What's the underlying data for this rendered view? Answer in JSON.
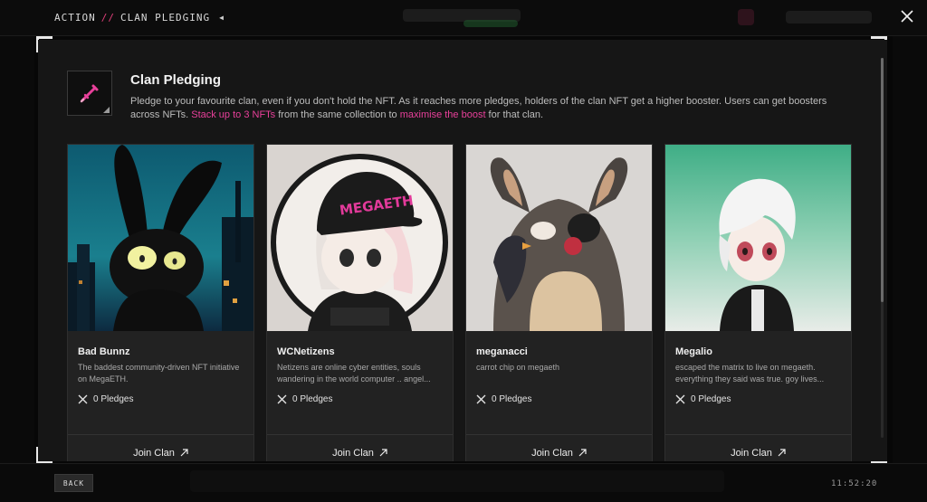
{
  "breadcrumb": {
    "section": "ACTION",
    "separator": "//",
    "page": "CLAN PLEDGING"
  },
  "modal": {
    "title": "Clan Pledging",
    "description_part1": "Pledge to your favourite clan, even if you don't hold the NFT. As it reaches more pledges, holders of the clan NFT get a higher booster. Users can get boosters across NFTs. ",
    "highlight1": "Stack up to 3 NFTs",
    "description_part2": " from the same collection to ",
    "highlight2": "maximise the boost",
    "description_part3": " for that clan."
  },
  "cards": [
    {
      "name": "Bad Bunnz",
      "description": "The baddest community-driven NFT initiative on MegaETH.",
      "pledges": "0 Pledges",
      "join_label": "Join Clan"
    },
    {
      "name": "WCNetizens",
      "description": "Netizens are online cyber entities, souls wandering in the world computer .. angel...",
      "pledges": "0 Pledges",
      "join_label": "Join Clan",
      "cap_text": "MEGAETH"
    },
    {
      "name": "meganacci",
      "description": "carrot chip on megaeth",
      "pledges": "0 Pledges",
      "join_label": "Join Clan"
    },
    {
      "name": "Megalio",
      "description": "escaped the matrix to live on megaeth. everything they said was true. goy lives...",
      "pledges": "0 Pledges",
      "join_label": "Join Clan"
    }
  ],
  "footer": {
    "back_label": "BACK",
    "clock": "11:52:20"
  },
  "icons": {
    "header": "crossed-swords-icon",
    "pledge": "crossed-swords-icon",
    "join": "arrow-up-right-icon",
    "close": "close-icon"
  },
  "colors": {
    "accent": "#e8409a",
    "modal_bg": "#161616",
    "card_bg": "#222222"
  }
}
